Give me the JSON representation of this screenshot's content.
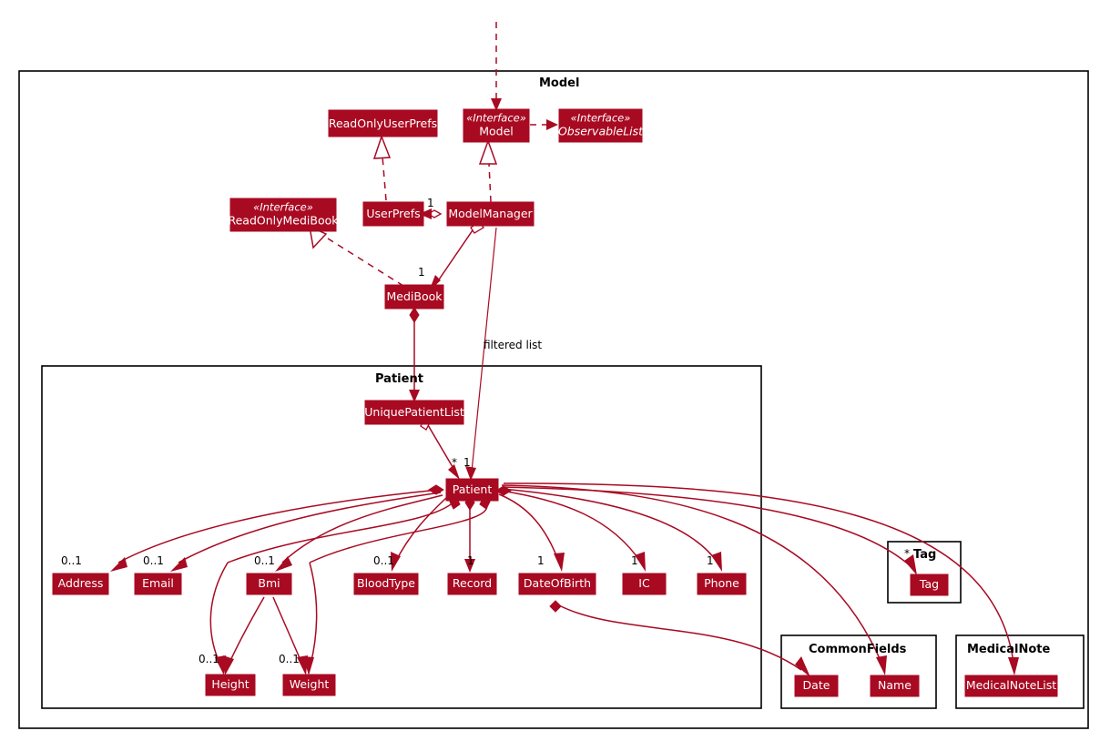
{
  "diagram": {
    "kind": "uml-class-diagram",
    "accent_color": "#A80A22",
    "background_color": "#FFFFFF",
    "border_color": "#000000"
  },
  "packages": {
    "model": {
      "title": "Model"
    },
    "patient": {
      "title": "Patient"
    },
    "tag": {
      "title": "Tag",
      "multiplicity": "*"
    },
    "common_fields": {
      "title": "CommonFields"
    },
    "medical_note": {
      "title": "MedicalNote"
    }
  },
  "classes": {
    "read_only_user_prefs": {
      "name": "ReadOnlyUserPrefs",
      "stereotype": ""
    },
    "model_interface": {
      "name": "Model",
      "stereotype": "«Interface»"
    },
    "observable_list": {
      "name": "ObservableList",
      "stereotype": "«Interface»"
    },
    "read_only_medibook": {
      "name": "ReadOnlyMediBook",
      "stereotype": "«Interface»"
    },
    "user_prefs": {
      "name": "UserPrefs",
      "stereotype": ""
    },
    "model_manager": {
      "name": "ModelManager",
      "stereotype": ""
    },
    "medibook": {
      "name": "MediBook",
      "stereotype": ""
    },
    "unique_patient_list": {
      "name": "UniquePatientList",
      "stereotype": ""
    },
    "patient": {
      "name": "Patient",
      "stereotype": ""
    },
    "address": {
      "name": "Address",
      "stereotype": ""
    },
    "email": {
      "name": "Email",
      "stereotype": ""
    },
    "bmi": {
      "name": "Bmi",
      "stereotype": ""
    },
    "blood_type": {
      "name": "BloodType",
      "stereotype": ""
    },
    "record": {
      "name": "Record",
      "stereotype": ""
    },
    "date_of_birth": {
      "name": "DateOfBirth",
      "stereotype": ""
    },
    "ic": {
      "name": "IC",
      "stereotype": ""
    },
    "phone": {
      "name": "Phone",
      "stereotype": ""
    },
    "height": {
      "name": "Height",
      "stereotype": ""
    },
    "weight": {
      "name": "Weight",
      "stereotype": ""
    },
    "tag": {
      "name": "Tag",
      "stereotype": ""
    },
    "date": {
      "name": "Date",
      "stereotype": ""
    },
    "name": {
      "name": "Name",
      "stereotype": ""
    },
    "medical_note_list": {
      "name": "MedicalNoteList",
      "stereotype": ""
    }
  },
  "multiplicities": {
    "user_prefs_one": "1",
    "medibook_one": "1",
    "patient_star": "*",
    "patient_one": "1",
    "address": "0..1",
    "email": "0..1",
    "bmi": "0..1",
    "blood_type": "0..1",
    "record": "1",
    "date_of_birth": "1",
    "ic": "1",
    "phone": "1",
    "height": "0..1",
    "weight": "0..1",
    "tag_star": "*"
  },
  "edge_labels": {
    "filtered_list": "filtered list"
  }
}
